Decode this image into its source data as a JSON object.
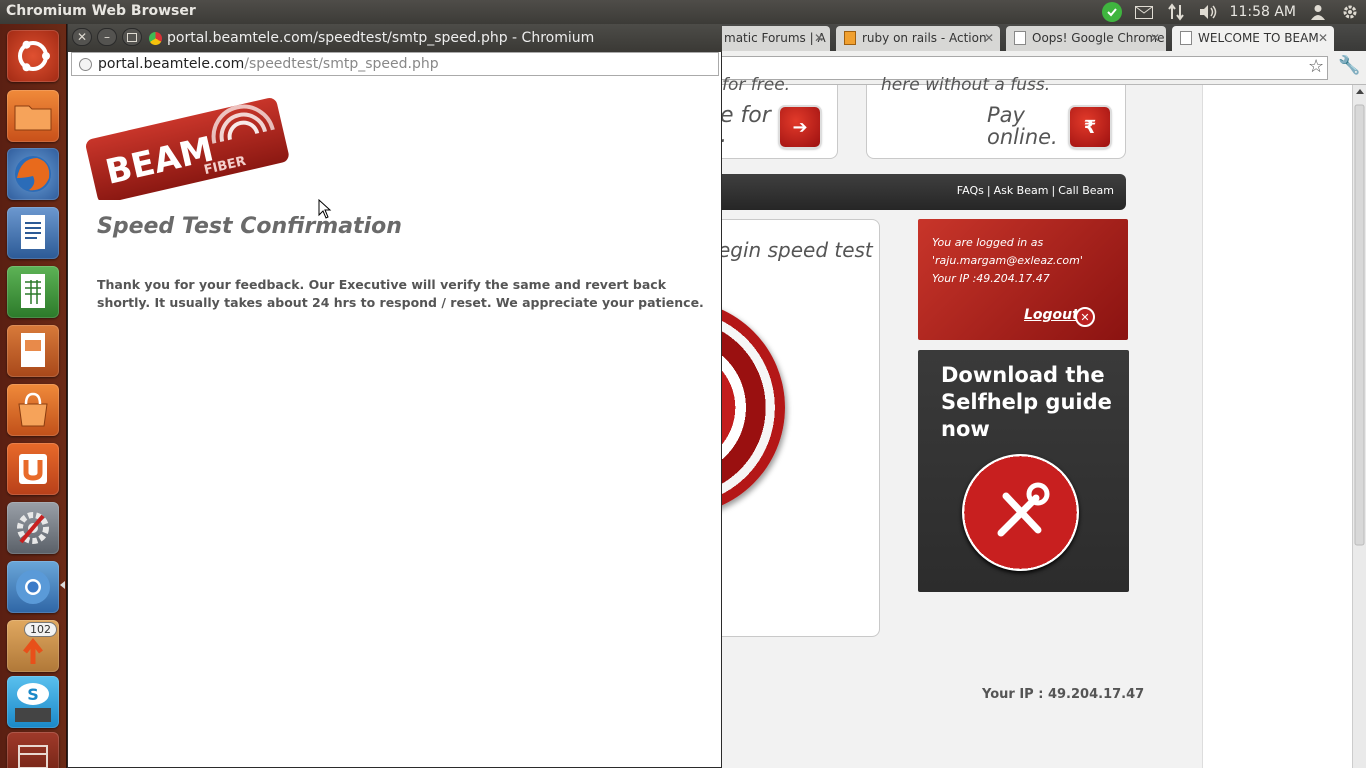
{
  "system": {
    "app_title": "Chromium Web Browser",
    "clock": "11:58 AM"
  },
  "launcher": {
    "items": [
      "Dash Home",
      "Files",
      "Firefox",
      "LibreOffice Writer",
      "LibreOffice Calc",
      "LibreOffice Impress",
      "Ubuntu Software Center",
      "Ubuntu One",
      "System Settings",
      "Chromium",
      "Update Manager",
      "Skype",
      "Workspace Switcher",
      "Workspace"
    ],
    "update_badge": "102"
  },
  "background_browser": {
    "tabs": [
      {
        "label": "matic Forums | A",
        "active": false
      },
      {
        "label": "ruby on rails - Action",
        "active": false
      },
      {
        "label": "Oops! Google Chrome",
        "active": false
      },
      {
        "label": "WELCOME TO BEAM",
        "active": true
      }
    ],
    "promo_left_line1": "for free.",
    "promo_left_line2": "e for",
    "promo_left_line3": ".",
    "promo_right_line0": "here without a fuss.",
    "promo_right_line1": "Pay",
    "promo_right_line2": "online.",
    "nav_links": [
      "FAQs",
      "Ask Beam",
      "Call Beam"
    ],
    "begin_text": "egin speed test",
    "login": {
      "line1": "You are logged in as",
      "line2": "'raju.margam@exleaz.com'",
      "line3": "Your IP :49.204.17.47",
      "logout": "Logout"
    },
    "selfhelp_title": "Download the Selfhelp guide now",
    "footer_ip": "Your IP : 49.204.17.47"
  },
  "popup": {
    "window_title": "portal.beamtele.com/speedtest/smtp_speed.php - Chromium",
    "url_host": "portal.beamtele.com",
    "url_path": "/speedtest/smtp_speed.php",
    "logo_text": "BEAM",
    "logo_sub": "FIBER",
    "heading": "Speed Test Confirmation",
    "message": "Thank you for your feedback. Our Executive will verify the same and revert back shortly. It usually takes about 24 hrs to respond / reset. We appreciate your patience."
  }
}
